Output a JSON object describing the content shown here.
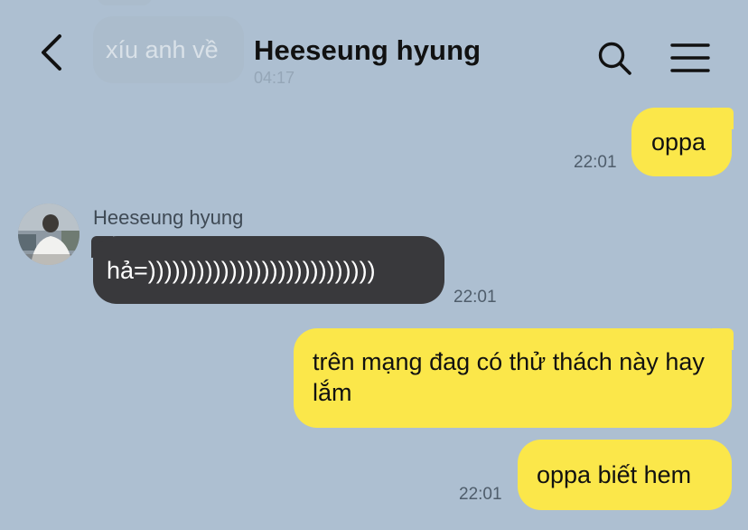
{
  "previous_message": {
    "text": "xíu anh về",
    "time": "04:17"
  },
  "header": {
    "title": "Heeseung hyung",
    "back_icon": "back-chevron-icon",
    "search_icon": "search-icon",
    "menu_icon": "hamburger-menu-icon"
  },
  "messages": [
    {
      "sender": "me",
      "text": "oppa",
      "time": "22:01"
    },
    {
      "sender": "Heeseung hyung",
      "text": "hả=))))))))))))))))))))))))))))",
      "time": "22:01"
    },
    {
      "sender": "me",
      "text": "trên mạng đag có thử thách này hay lắm",
      "time": ""
    },
    {
      "sender": "me",
      "text": "oppa biết hem",
      "time": "22:01"
    }
  ],
  "colors": {
    "background": "#adbfd1",
    "my_bubble": "#fbe74a",
    "their_bubble": "#39393c"
  }
}
